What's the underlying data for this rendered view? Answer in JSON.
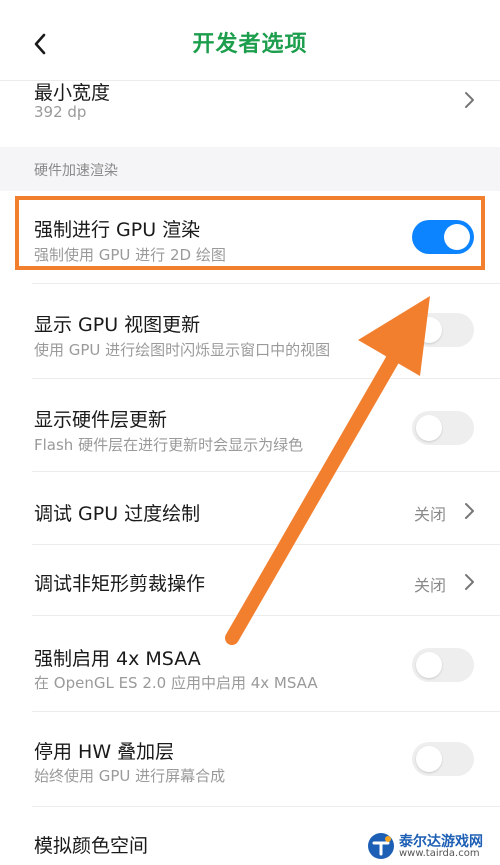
{
  "header": {
    "title": "开发者选项",
    "back_icon": "chevron-left-icon"
  },
  "min_width": {
    "title": "最小宽度",
    "value": "392 dp"
  },
  "section": {
    "label": "硬件加速渲染"
  },
  "rows": [
    {
      "title": "强制进行 GPU 渲染",
      "subtitle": "强制使用 GPU 进行 2D 绘图",
      "toggle": true
    },
    {
      "title": "显示 GPU 视图更新",
      "subtitle": "使用 GPU 进行绘图时闪烁显示窗口中的视图",
      "toggle": false
    },
    {
      "title": "显示硬件层更新",
      "subtitle": "Flash 硬件层在进行更新时会显示为绿色",
      "toggle": false
    },
    {
      "title": "调试 GPU 过度绘制",
      "status": "关闭"
    },
    {
      "title": "调试非矩形剪裁操作",
      "status": "关闭"
    },
    {
      "title": "强制启用 4x MSAA",
      "subtitle": "在 OpenGL ES 2.0 应用中启用 4x MSAA",
      "toggle": false
    },
    {
      "title": "停用 HW 叠加层",
      "subtitle": "始终使用 GPU 进行屏幕合成",
      "toggle": false
    },
    {
      "title": "模拟颜色空间"
    }
  ],
  "colors": {
    "accent_green": "#1d9e4d",
    "toggle_on": "#0d84ff",
    "highlight": "#f27f2e"
  },
  "watermark": {
    "name": "泰尔达游戏网",
    "url": "www.tairda.com"
  }
}
